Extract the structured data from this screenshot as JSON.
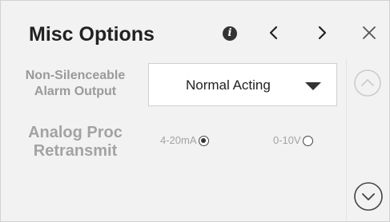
{
  "header": {
    "title": "Misc Options",
    "info_icon": "info-icon",
    "prev_icon": "chevron-left-icon",
    "next_icon": "chevron-right-icon",
    "close_icon": "close-icon"
  },
  "settings": {
    "alarm_output": {
      "label_line1": "Non-Silenceable",
      "label_line2": "Alarm Output",
      "selected_value": "Normal Acting"
    },
    "analog_retransmit": {
      "label_line1": "Analog Proc",
      "label_line2": "Retransmit",
      "options": [
        {
          "label": "4-20mA",
          "selected": true
        },
        {
          "label": "0-10V",
          "selected": false
        }
      ]
    }
  },
  "scroll": {
    "up_icon": "chevron-up-circle-icon",
    "down_icon": "chevron-down-circle-icon",
    "up_enabled": false,
    "down_enabled": true
  },
  "colors": {
    "background": "#f2f2f2",
    "title_text": "#222222",
    "label_text": "#9a9a9a",
    "disabled_icon": "#c8c8c8",
    "enabled_icon": "#444444"
  }
}
